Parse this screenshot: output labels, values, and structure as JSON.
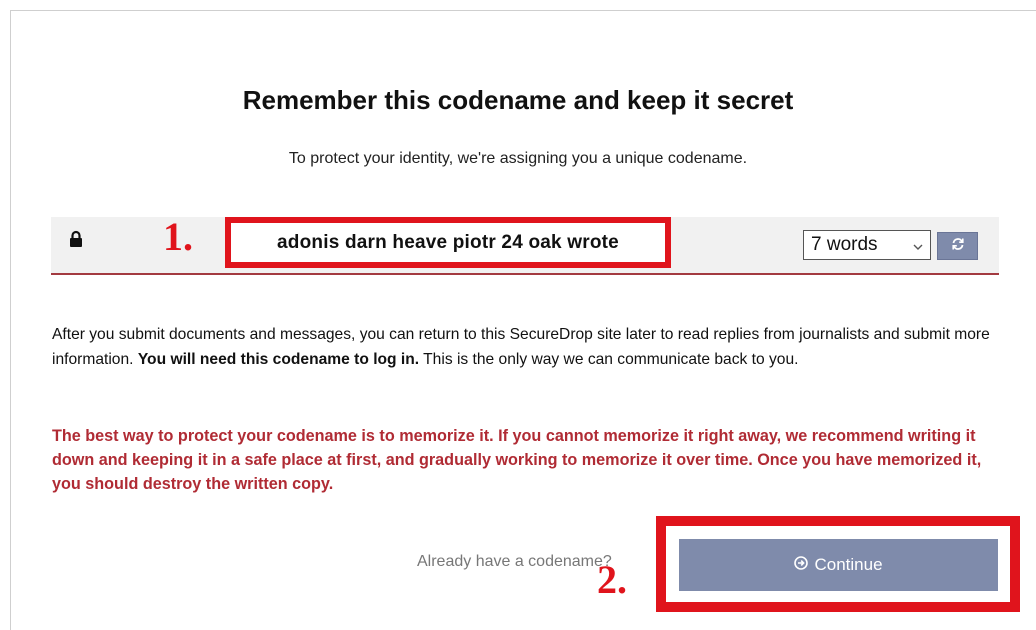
{
  "header": {
    "title": "Remember this codename and keep it secret",
    "subtitle": "To protect your identity, we're assigning you a unique codename."
  },
  "codename": {
    "value": "adonis darn heave piotr 24 oak wrote",
    "lock_icon": "lock-icon",
    "word_count_select": {
      "selected": "7 words"
    },
    "refresh_icon": "refresh-icon"
  },
  "annotations": {
    "label_1": "1.",
    "label_2": "2.",
    "color": "#e0141c"
  },
  "info": {
    "text_before": "After you submit documents and messages, you can return to this SecureDrop site later to read replies from journalists and submit more information. ",
    "text_bold": "You will need this codename to log in.",
    "text_after": " This is the only way we can communicate back to you."
  },
  "warning": {
    "text": "The best way to protect your codename is to memorize it. If you cannot memorize it right away, we recommend writing it down and keeping it in a safe place at first, and gradually working to memorize it over time. Once you have memorized it, you should destroy the written copy."
  },
  "actions": {
    "already_have_label": "Already have a codename?",
    "continue_label": "Continue",
    "continue_icon": "arrow-circle-right-icon"
  },
  "colors": {
    "accent": "#7f8bab",
    "warning": "#b02b34",
    "divider": "#a33a40"
  }
}
